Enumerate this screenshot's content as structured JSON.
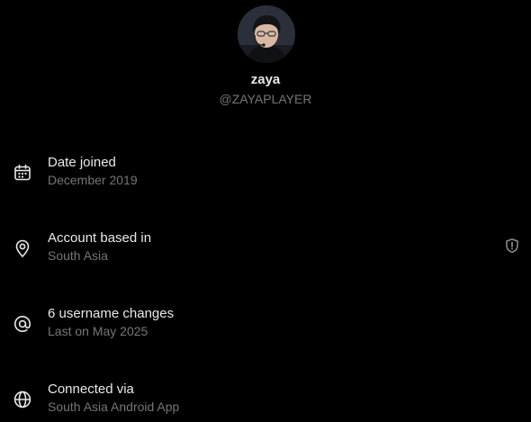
{
  "profile": {
    "display_name": "zaya",
    "handle": "@ZAYAPLAYER"
  },
  "details": [
    {
      "icon": "calendar-icon",
      "title": "Date joined",
      "subtitle": "December 2019"
    },
    {
      "icon": "location-pin-icon",
      "title": "Account based in",
      "subtitle": "South Asia",
      "trailing_icon": "shield-alert-icon"
    },
    {
      "icon": "at-sign-icon",
      "title": "6 username changes",
      "subtitle": "Last on May 2025"
    },
    {
      "icon": "globe-icon",
      "title": "Connected via",
      "subtitle": "South Asia Android App"
    }
  ],
  "colors": {
    "background": "#000000",
    "primary_text": "#e7e9ea",
    "secondary_text": "#71767b"
  }
}
